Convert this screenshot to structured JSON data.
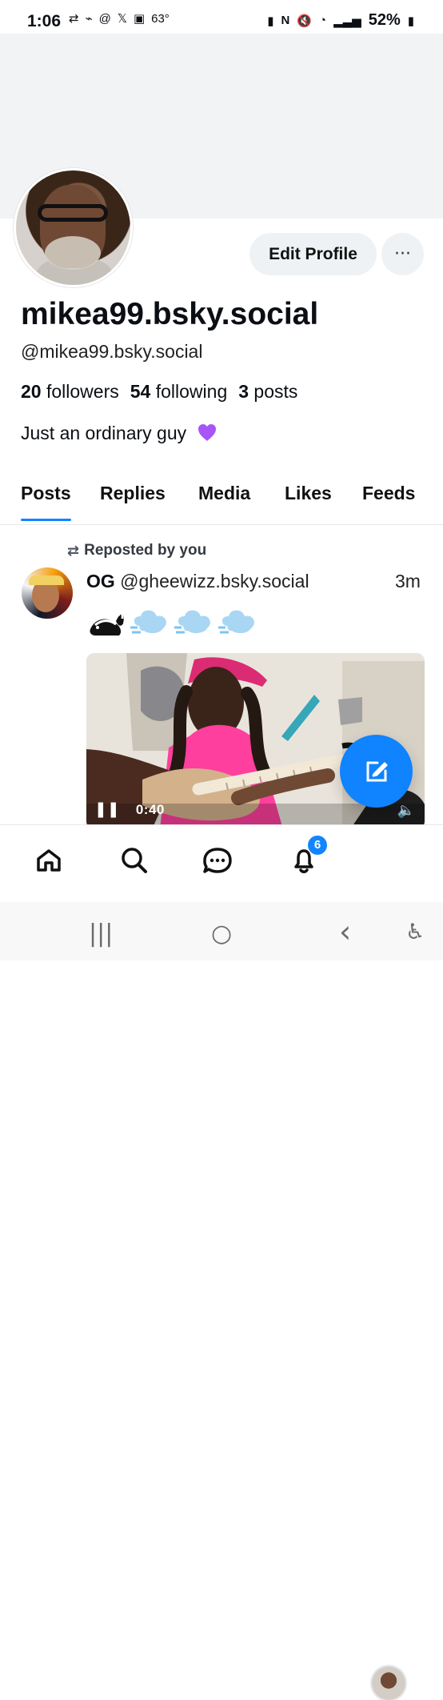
{
  "status_bar": {
    "time": "1:06",
    "temperature": "63°",
    "battery": "52%",
    "left_icons": [
      "sync-icon",
      "signal-activity-icon",
      "threads-icon",
      "x-icon",
      "image-icon"
    ],
    "right_icons": [
      "battery-saver-icon",
      "nfc-icon",
      "mute-icon",
      "wifi-icon",
      "signal-icon",
      "battery-icon"
    ]
  },
  "profile": {
    "display_name": "mikea99.bsky.social",
    "handle": "@mikea99.bsky.social",
    "followers_count": "20",
    "followers_label": "followers",
    "following_count": "54",
    "following_label": "following",
    "posts_count": "3",
    "posts_label": "posts",
    "bio": "Just an ordinary guy",
    "edit_button": "Edit Profile",
    "more_button": "···"
  },
  "tabs": [
    {
      "label": "Posts",
      "active": true
    },
    {
      "label": "Replies",
      "active": false
    },
    {
      "label": "Media",
      "active": false
    },
    {
      "label": "Likes",
      "active": false
    },
    {
      "label": "Feeds",
      "active": false
    }
  ],
  "post": {
    "repost_label": "Reposted by you",
    "author_name": "OG",
    "author_handle": "@gheewizz.bsky.social",
    "time": "3m",
    "video": {
      "time": "0:40"
    }
  },
  "bottom_nav": {
    "notification_count": "6",
    "items": [
      "home",
      "search",
      "chat",
      "notifications",
      "profile"
    ]
  },
  "android_nav": {
    "recent_apps": "|||",
    "home": "○",
    "back": "‹",
    "accessibility": "♿"
  },
  "colors": {
    "accent": "#1185fe",
    "banner": "#f1f3f5",
    "button_background": "#eff2f4"
  }
}
